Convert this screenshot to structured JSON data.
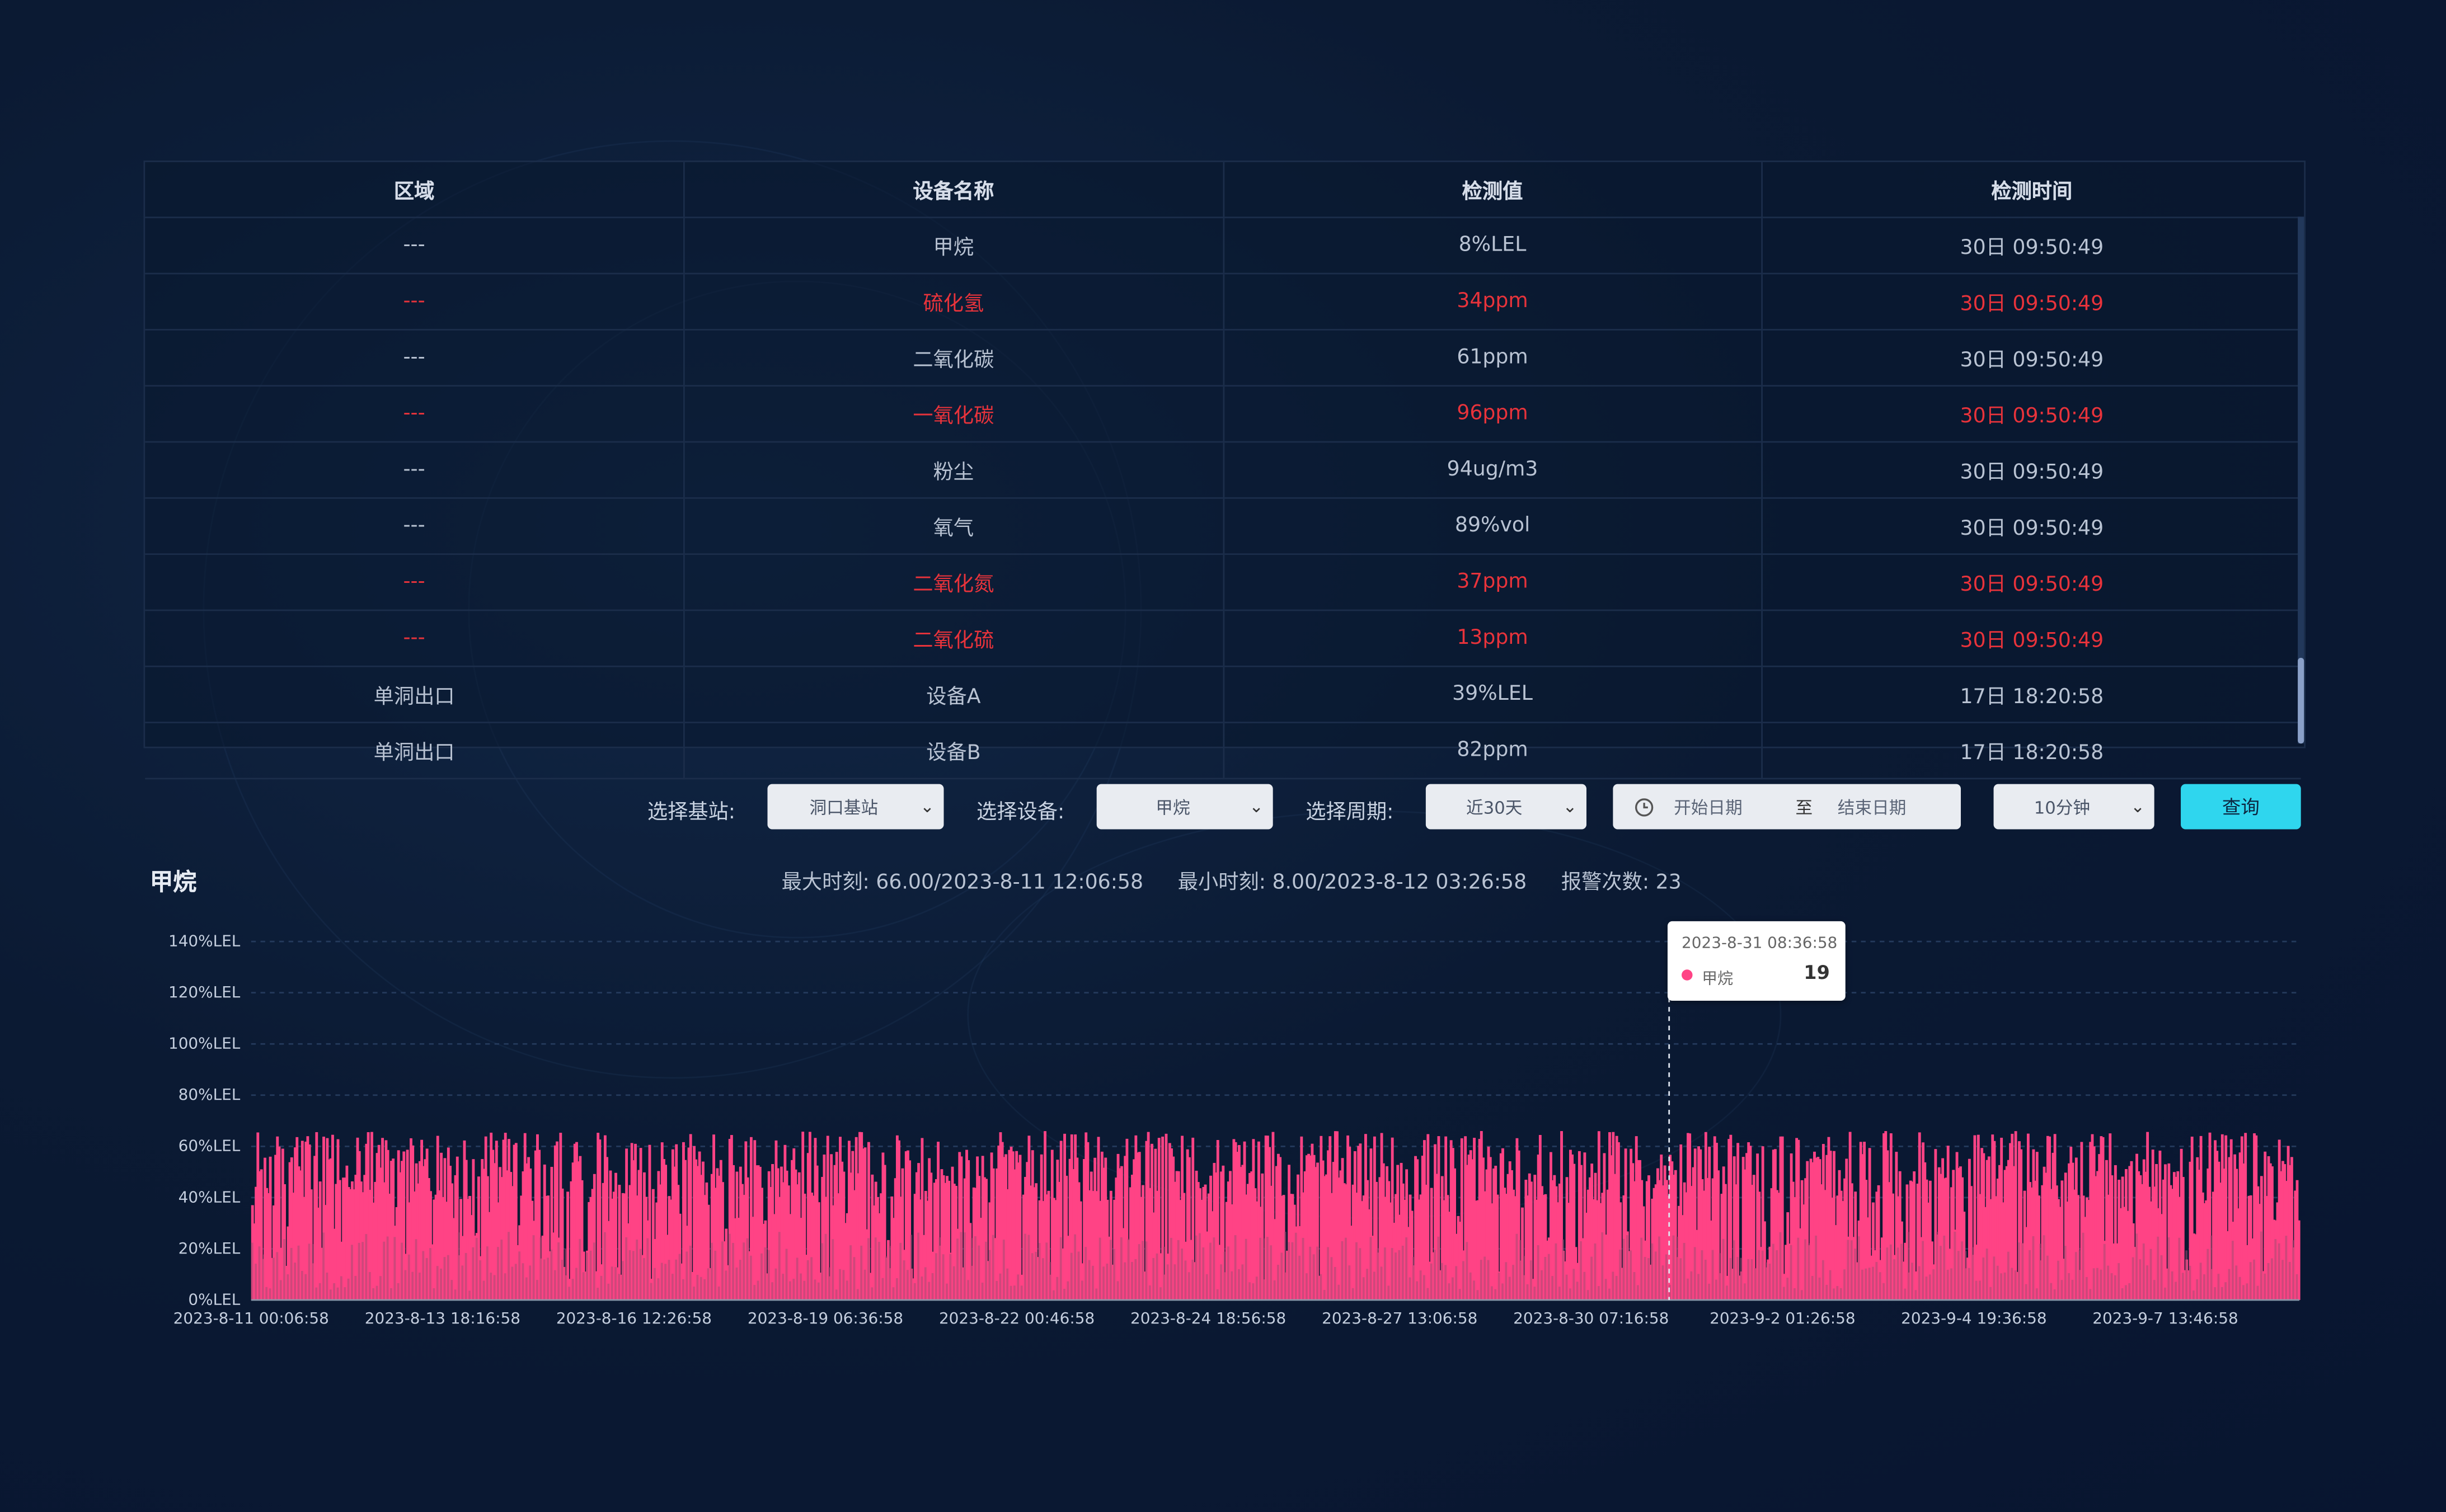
{
  "table": {
    "headers": [
      "区域",
      "设备名称",
      "检测值",
      "检测时间"
    ],
    "rows": [
      {
        "area": "---",
        "device": "甲烷",
        "value": "8%LEL",
        "time": "30日 09:50:49",
        "alert": false
      },
      {
        "area": "---",
        "device": "硫化氢",
        "value": "34ppm",
        "time": "30日 09:50:49",
        "alert": true
      },
      {
        "area": "---",
        "device": "二氧化碳",
        "value": "61ppm",
        "time": "30日 09:50:49",
        "alert": false
      },
      {
        "area": "---",
        "device": "一氧化碳",
        "value": "96ppm",
        "time": "30日 09:50:49",
        "alert": true
      },
      {
        "area": "---",
        "device": "粉尘",
        "value": "94ug/m3",
        "time": "30日 09:50:49",
        "alert": false
      },
      {
        "area": "---",
        "device": "氧气",
        "value": "89%vol",
        "time": "30日 09:50:49",
        "alert": false
      },
      {
        "area": "---",
        "device": "二氧化氮",
        "value": "37ppm",
        "time": "30日 09:50:49",
        "alert": true
      },
      {
        "area": "---",
        "device": "二氧化硫",
        "value": "13ppm",
        "time": "30日 09:50:49",
        "alert": true
      },
      {
        "area": "单洞出口",
        "device": "设备A",
        "value": "39%LEL",
        "time": "17日 18:20:58",
        "alert": false
      },
      {
        "area": "单洞出口",
        "device": "设备B",
        "value": "82ppm",
        "time": "17日 18:20:58",
        "alert": false
      }
    ]
  },
  "filters": {
    "station_label": "选择基站:",
    "station_value": "洞口基站",
    "device_label": "选择设备:",
    "device_value": "甲烷",
    "period_label": "选择周期:",
    "period_value": "近30天",
    "start_placeholder": "开始日期",
    "range_sep": "至",
    "end_placeholder": "结束日期",
    "interval_value": "10分钟",
    "query_label": "查询"
  },
  "chart_header": {
    "title": "甲烷",
    "max_text": "最大时刻: 66.00/2023-8-11 12:06:58",
    "min_text": "最小时刻: 8.00/2023-8-12 03:26:58",
    "alarm_text": "报警次数: 23"
  },
  "tooltip": {
    "time": "2023-8-31 08:36:58",
    "series": "甲烷",
    "value": "19"
  },
  "colors": {
    "series": "#ff4385",
    "series_dark": "#a84a73",
    "alert_text": "#e8333b",
    "button": "#2fd6ee"
  },
  "chart_data": {
    "type": "area",
    "series": [
      {
        "name": "甲烷"
      }
    ],
    "y_ticks": [
      "0%LEL",
      "20%LEL",
      "40%LEL",
      "60%LEL",
      "80%LEL",
      "100%LEL",
      "120%LEL",
      "140%LEL"
    ],
    "x_ticks": [
      "2023-8-11 00:06:58",
      "2023-8-13 18:16:58",
      "2023-8-16 12:26:58",
      "2023-8-19 06:36:58",
      "2023-8-22 00:46:58",
      "2023-8-24 18:56:58",
      "2023-8-27 13:06:58",
      "2023-8-30 07:16:58",
      "2023-9-2 01:26:58",
      "2023-9-4 19:36:58",
      "2023-9-7 13:46:58"
    ],
    "ylim": [
      0,
      140
    ],
    "value_range": [
      8,
      66
    ],
    "approx_sample_count": 1150,
    "grid": true,
    "legend": "none",
    "x_range": [
      "2023-8-11 00:06:58",
      "2023-9-9 23:56:58"
    ]
  }
}
